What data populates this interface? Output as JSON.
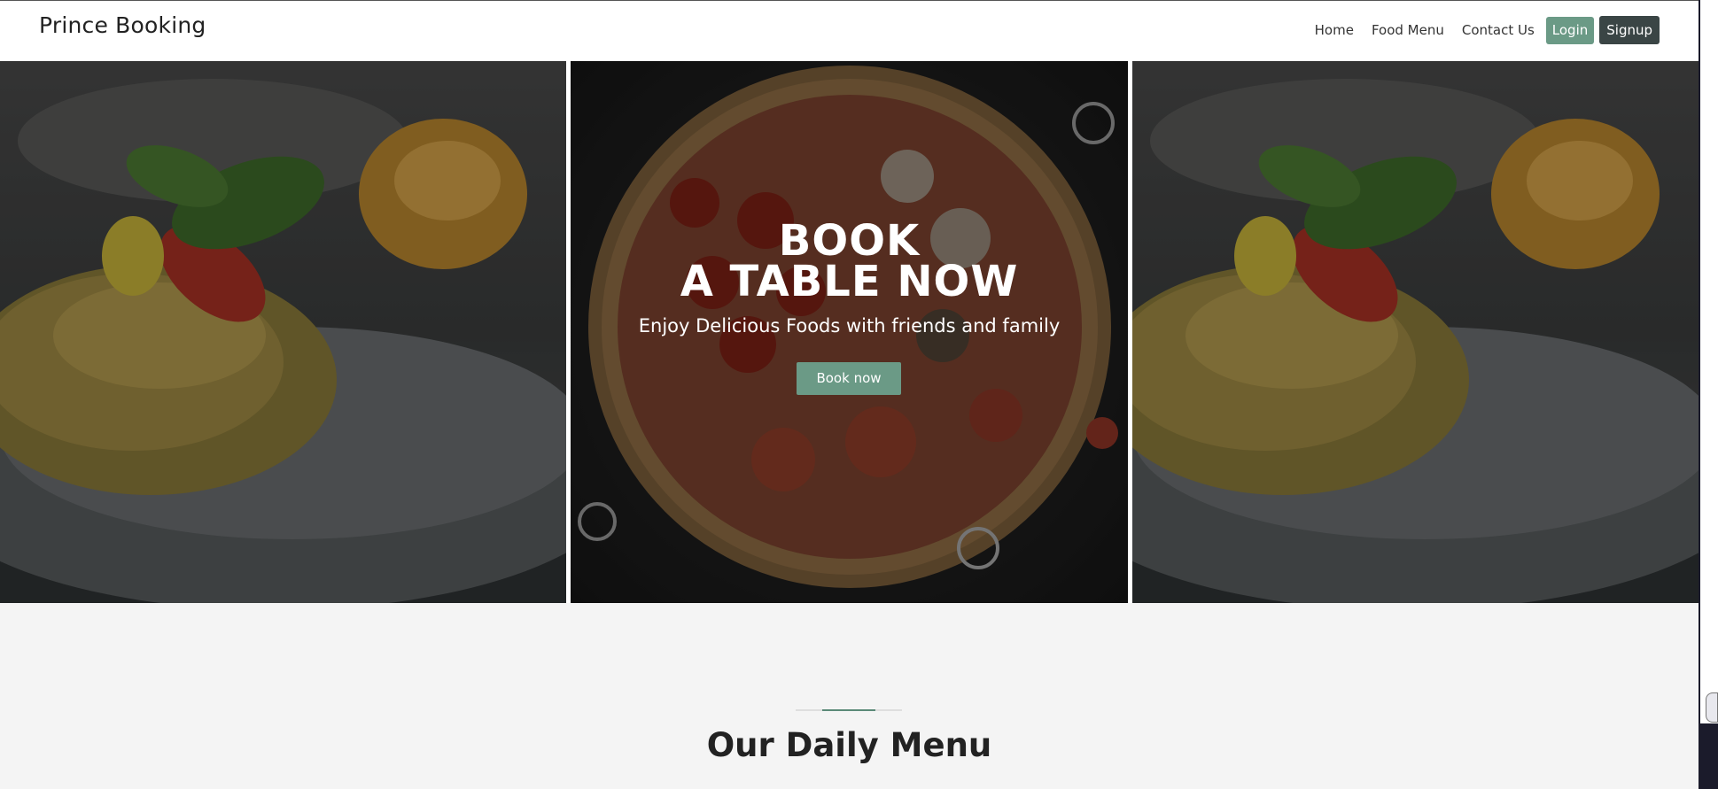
{
  "navbar": {
    "brand": "Prince Booking",
    "links": [
      "Home",
      "Food Menu",
      "Contact Us"
    ],
    "login_label": "Login",
    "signup_label": "Signup"
  },
  "hero": {
    "title_line1": "BOOK",
    "title_line2": "A TABLE NOW",
    "subtitle": "Enjoy Delicious Foods with friends and family",
    "button_label": "Book now"
  },
  "menu_section": {
    "title": "Our Daily Menu"
  },
  "colors": {
    "accent": "#6b9a86",
    "dark_button": "#3a4545"
  }
}
